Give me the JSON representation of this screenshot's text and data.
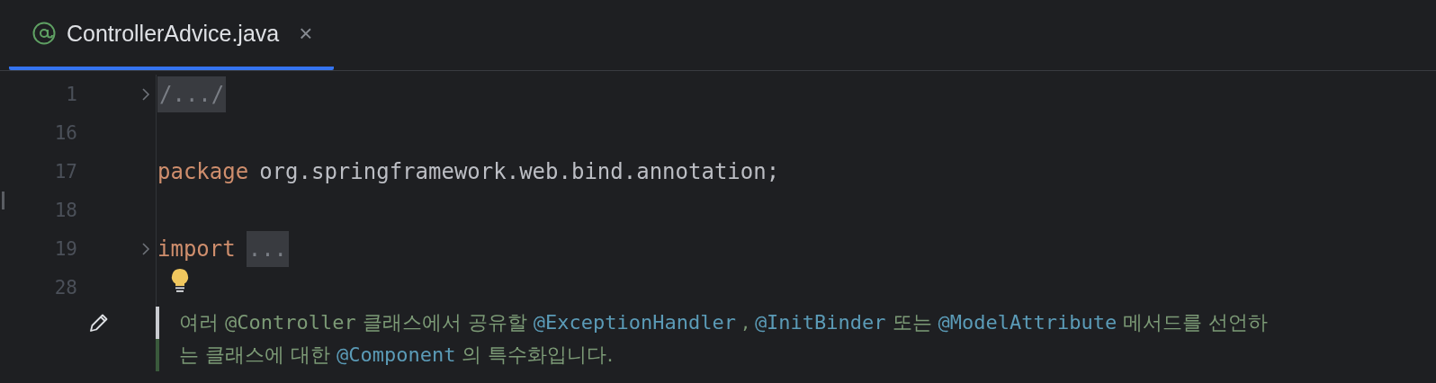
{
  "tabs": [
    {
      "label": "ControllerAdvice.java",
      "selected": true,
      "close": "×"
    }
  ],
  "lines": [
    {
      "number": "1",
      "fold": true,
      "tokens": [
        {
          "kind": "folded",
          "text": "/.../"
        }
      ]
    },
    {
      "number": "16",
      "fold": false
    },
    {
      "number": "17",
      "fold": false,
      "tokens": [
        {
          "kind": "keyword",
          "text": "package"
        },
        {
          "kind": "plain",
          "text": "org.springframework.web.bind.annotation;"
        }
      ]
    },
    {
      "number": "18",
      "fold": false
    },
    {
      "number": "19",
      "fold": true,
      "tokens": [
        {
          "kind": "keyword",
          "text": "import"
        },
        {
          "kind": "folded",
          "text": "..."
        }
      ]
    },
    {
      "number": "28",
      "fold": false
    }
  ],
  "doc": [
    [
      {
        "kind": "text",
        "text": "여러"
      },
      {
        "kind": "code",
        "text": "@Controller"
      },
      {
        "kind": "text",
        "text": "클래스에서 공유할"
      },
      {
        "kind": "link",
        "text": "@ExceptionHandler"
      },
      {
        "kind": "text",
        "text": ","
      },
      {
        "kind": "link",
        "text": "@InitBinder"
      },
      {
        "kind": "text",
        "text": "또는"
      },
      {
        "kind": "link",
        "text": "@ModelAttribute"
      },
      {
        "kind": "text",
        "text": "메서드를 선언하"
      }
    ],
    [
      {
        "kind": "text",
        "text": "는 클래스에 대한"
      },
      {
        "kind": "link",
        "text": "@Component"
      },
      {
        "kind": "text",
        "text": "의 특수화입니다."
      }
    ]
  ]
}
